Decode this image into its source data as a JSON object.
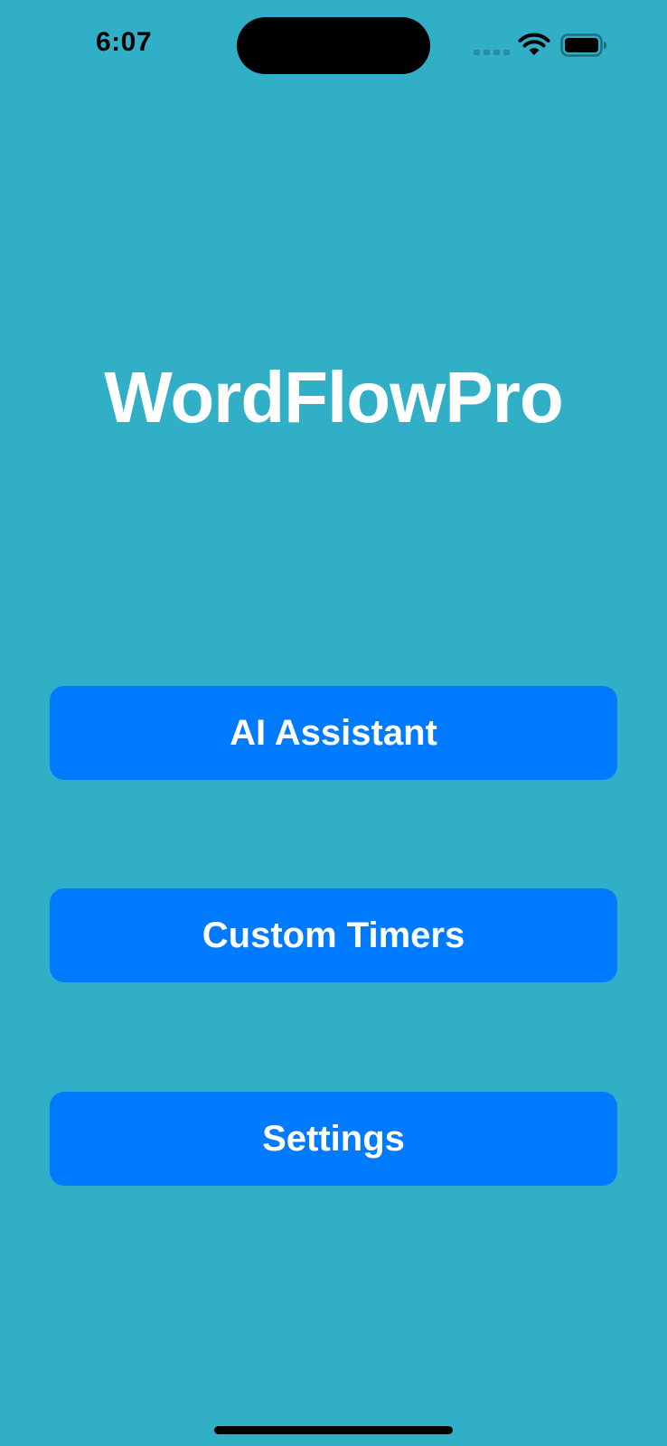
{
  "status_bar": {
    "time": "6:07",
    "icons": [
      "cellular-signal-icon",
      "wifi-icon",
      "battery-icon"
    ]
  },
  "app": {
    "title": "WordFlowPro"
  },
  "menu": {
    "items": [
      {
        "label": "AI Assistant"
      },
      {
        "label": "Custom Timers"
      },
      {
        "label": "Settings"
      }
    ]
  },
  "colors": {
    "background": "#30AFC6",
    "button": "#007AFF",
    "button_text": "#FFFFFF",
    "title_text": "#FFFFFF"
  }
}
